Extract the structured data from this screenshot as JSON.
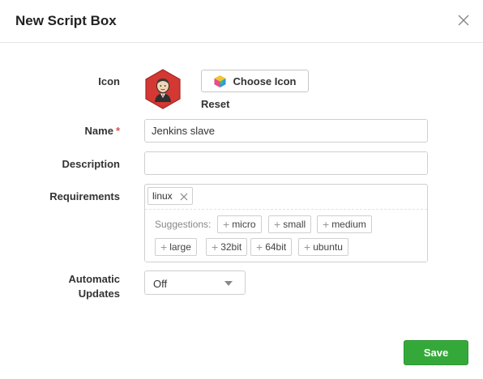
{
  "dialog": {
    "title": "New Script Box"
  },
  "icon_field": {
    "label": "Icon",
    "choose_label": "Choose Icon",
    "reset_label": "Reset"
  },
  "name_field": {
    "label": "Name",
    "required_mark": "*",
    "value": "Jenkins slave"
  },
  "description_field": {
    "label": "Description",
    "value": ""
  },
  "requirements_field": {
    "label": "Requirements",
    "tags": [
      "linux"
    ],
    "suggestions_label": "Suggestions:",
    "suggestions": [
      "micro",
      "small",
      "medium",
      "large",
      "32bit",
      "64bit",
      "ubuntu"
    ]
  },
  "updates_field": {
    "label_line1": "Automatic",
    "label_line2": "Updates",
    "selected": "Off"
  },
  "footer": {
    "save_label": "Save"
  },
  "colors": {
    "save_green": "#34a93a",
    "required_red": "#d9534f",
    "jenkins_red": "#d33833"
  },
  "icons": {
    "close": "close-icon",
    "app_icon": "jenkins-logo",
    "choose": "color-cube-icon",
    "tag_remove": "close-icon",
    "dropdown": "caret-down-icon"
  }
}
